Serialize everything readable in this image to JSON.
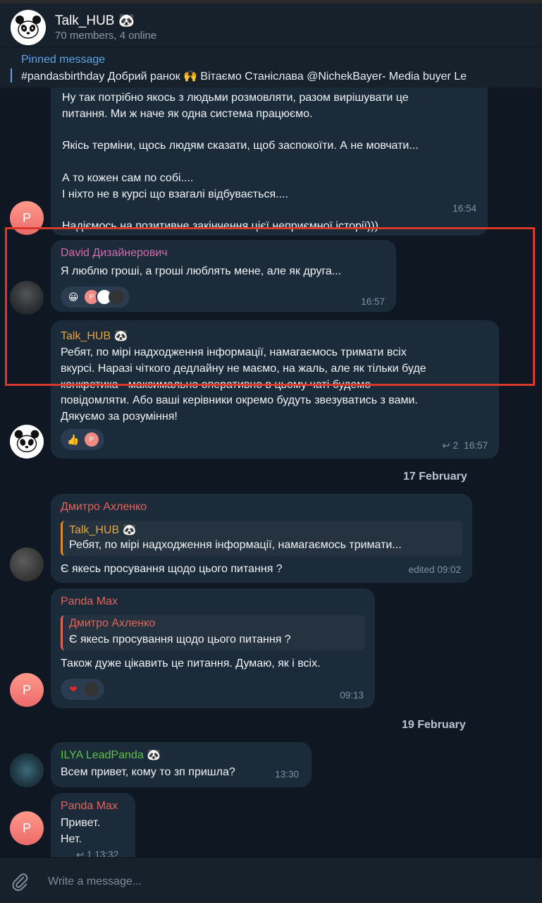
{
  "header": {
    "title": "Talk_HUB 🐼",
    "subtitle": "70 members, 4 online"
  },
  "pinned": {
    "label": "Pinned message",
    "text": "#pandasbirthday  Добрий ранок 🙌 Вітаємо Станіслава @NichekBayer- Media buyer  Le"
  },
  "messages": [
    {
      "text": "Ну так потрібно якось з людьми розмовляти, разом вирішувати це\nпитання. Ми ж наче як одна система працюємо.\n\nЯкісь терміни, щось людям сказати, щоб заспокоїти. А не мовчати...\n\nА то кожен сам по собі....\nІ ніхто не в курсі що взагалі відбувається....\n\nНадіємось на позитивне закінчення цієї неприємної історії)))",
      "time": "16:54",
      "avatar_letter": "P"
    },
    {
      "name": "David Дизайнерович",
      "name_color": "#d56aaf",
      "text": "Я люблю гроші, а гроші люблять мене, але як друга...",
      "time": "16:57"
    },
    {
      "name": "Talk_HUB 🐼",
      "name_color": "#e0a64a",
      "text": "Ребят, по мірі надходження інформації, намагаємось тримати всіх\nвкурсі. Наразі чіткого дедлайну не маємо, на жаль, але як тільки буде\nконкретика - максимально оперативно в цьому чаті будемо\nповідомляти. Або ваші керівники окремо будуть звезуватись з вами.\nДякуємо за розуміння!",
      "reply_count": "2",
      "time": "16:57"
    },
    {
      "name": "Дмитро Ахленко",
      "name_color": "#e0655a",
      "quote_name": "Talk_HUB 🐼",
      "quote_name_color": "#e0a64a",
      "quote_text": "Ребят, по мірі надходження інформації, намагаємось тримати...",
      "text": "Є якесь просування щодо цього питання ?",
      "time": "edited 09:02"
    },
    {
      "name": "Panda Max",
      "name_color": "#e0655a",
      "quote_name": "Дмитро Ахленко",
      "quote_name_color": "#e0655a",
      "quote_text": "Є якесь просування щодо цього питання ?",
      "text": "Також дуже цікавить це питання. Думаю, як і всіх.",
      "time": "09:13",
      "avatar_letter": "P"
    },
    {
      "name": "ILYA LeadPanda 🐼",
      "name_color": "#5fc04a",
      "text": "Всем привет, кому то зп пришла?",
      "time": "13:30"
    },
    {
      "name": "Panda Max",
      "name_color": "#e0655a",
      "text": "Привет.\nНет.",
      "reply_count": "1",
      "time": "13:32",
      "avatar_letter": "P"
    }
  ],
  "date_separators": [
    "17 February",
    "19 February"
  ],
  "reactions": {
    "smile": "😀",
    "thumbs_up": "👍",
    "heart": "❤",
    "reply_arrow": "↩"
  },
  "composer": {
    "placeholder": "Write a message..."
  },
  "colors": {
    "background": "#0f1822",
    "bubble": "#1c2b3a",
    "accent": "#5ea4e6",
    "highlight_box": "#d73a2a"
  }
}
